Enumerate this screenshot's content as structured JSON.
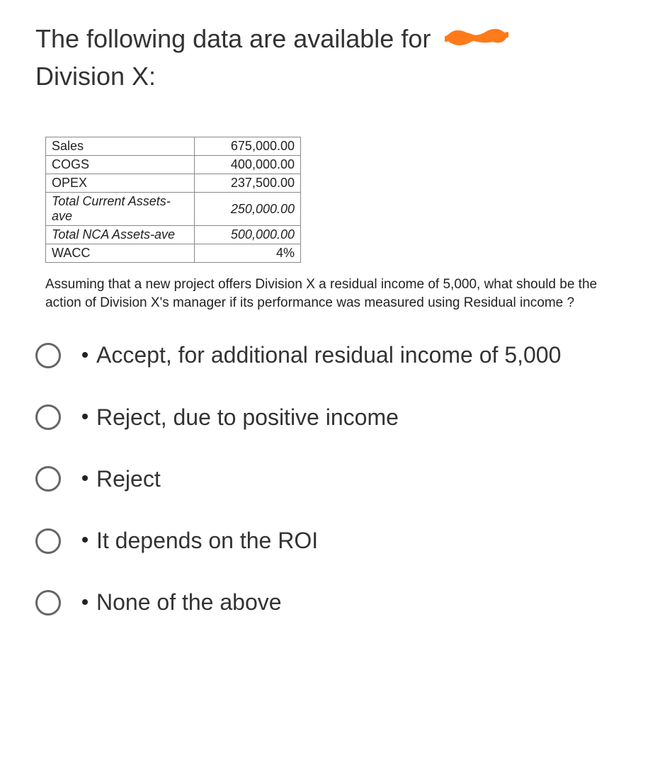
{
  "heading_part1": "The following data are available for",
  "heading_part2": "Division X:",
  "table": {
    "rows": [
      {
        "label": "Sales",
        "value": "675,000.00",
        "italic": false
      },
      {
        "label": "COGS",
        "value": "400,000.00",
        "italic": false
      },
      {
        "label": "OPEX",
        "value": "237,500.00",
        "italic": false
      },
      {
        "label": "Total Current Assets-ave",
        "value": "250,000.00",
        "italic": true
      },
      {
        "label": "Total NCA Assets-ave",
        "value": "500,000.00",
        "italic": true
      },
      {
        "label": "WACC",
        "value": "4%",
        "italic": false
      }
    ]
  },
  "assumption": "Assuming that a new project offers Division X a residual income of 5,000, what should be the action of Division X's manager if its performance was measured using Residual income ?",
  "options": [
    "Accept, for additional residual income of 5,000",
    "Reject, due to positive income",
    "Reject",
    "It depends on the ROI",
    "None of the above"
  ]
}
